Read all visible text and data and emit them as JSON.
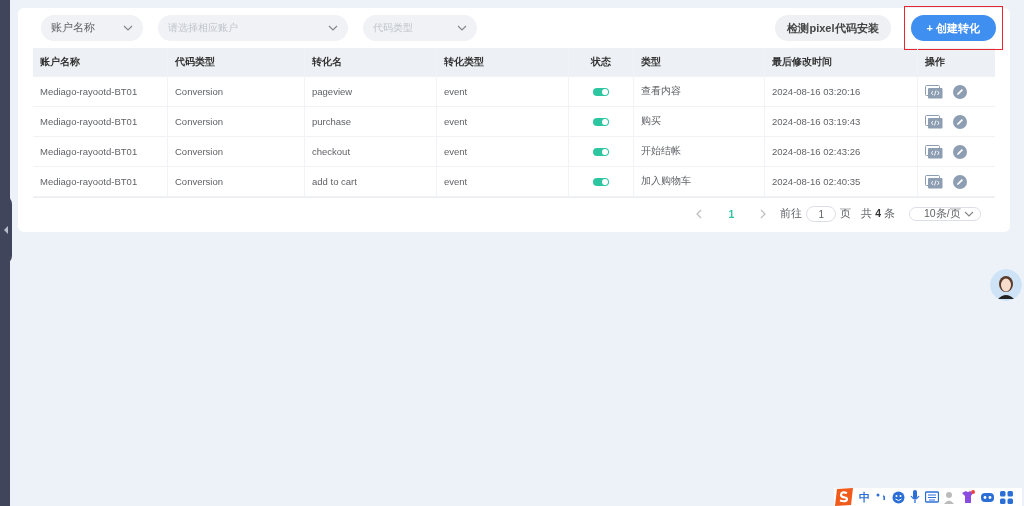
{
  "filters": [
    {
      "kind": "value",
      "text": "账户名称"
    },
    {
      "kind": "placeholder",
      "text": "请选择相应账户"
    },
    {
      "kind": "placeholder",
      "text": "代码类型"
    }
  ],
  "actions": [
    {
      "kind": "secondary",
      "label": "检测pixel代码安装",
      "highlighted": false
    },
    {
      "kind": "primary",
      "icon": "+",
      "label": "创建转化",
      "highlighted": true
    }
  ],
  "table": {
    "columns": [
      "账户名称",
      "代码类型",
      "转化名",
      "转化类型",
      "状态",
      "类型",
      "最后修改时间",
      "操作"
    ],
    "rows": [
      {
        "account": "Mediago-rayootd-BT01",
        "code_type": "Conversion",
        "name": "pageview",
        "conv_type": "event",
        "on": true,
        "type": "查看内容",
        "modified": "2024-08-16 03:20:16"
      },
      {
        "account": "Mediago-rayootd-BT01",
        "code_type": "Conversion",
        "name": "purchase",
        "conv_type": "event",
        "on": true,
        "type": "购买",
        "modified": "2024-08-16 03:19:43"
      },
      {
        "account": "Mediago-rayootd-BT01",
        "code_type": "Conversion",
        "name": "checkout",
        "conv_type": "event",
        "on": true,
        "type": "开始结帐",
        "modified": "2024-08-16 02:43:26"
      },
      {
        "account": "Mediago-rayootd-BT01",
        "code_type": "Conversion",
        "name": "add to cart",
        "conv_type": "event",
        "on": true,
        "type": "加入购物车",
        "modified": "2024-08-16 02:40:35"
      }
    ]
  },
  "pagination": {
    "pages": [
      {
        "label": "1",
        "selected": true
      }
    ],
    "goto_label": "前往",
    "goto_value": "1",
    "page_unit": "页",
    "total_prefix": "共",
    "total": "4",
    "total_suffix": "条",
    "page_size": "10条/页"
  },
  "ime_toolbar": {
    "mode": "中"
  }
}
